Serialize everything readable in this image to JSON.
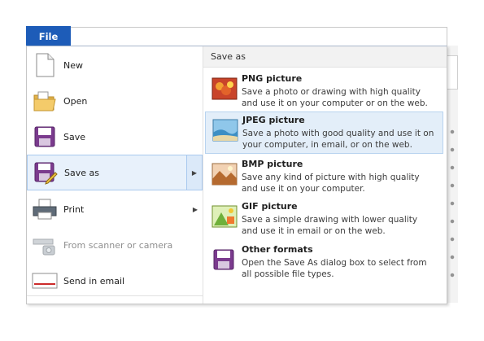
{
  "file_tab": {
    "label": "File"
  },
  "left_menu": {
    "items": [
      {
        "label": "New",
        "icon": "new-document-icon",
        "disabled": false,
        "submenu": false
      },
      {
        "label": "Open",
        "icon": "open-folder-icon",
        "disabled": false,
        "submenu": false
      },
      {
        "label": "Save",
        "icon": "save-floppy-icon",
        "disabled": false,
        "submenu": false
      },
      {
        "label": "Save as",
        "icon": "save-as-icon",
        "disabled": false,
        "submenu": true,
        "selected": true
      },
      {
        "label": "Print",
        "icon": "printer-icon",
        "disabled": false,
        "submenu": true
      },
      {
        "label": "From scanner or camera",
        "icon": "scanner-camera-icon",
        "disabled": true,
        "submenu": false
      },
      {
        "label": "Send in email",
        "icon": "email-icon",
        "disabled": false,
        "submenu": false
      }
    ],
    "submenu_arrow": "▶"
  },
  "save_as_panel": {
    "header": "Save as",
    "options": [
      {
        "title": "PNG picture",
        "description": "Save a photo or drawing with high quality and use it on your computer or on the web.",
        "icon": "png-picture-icon"
      },
      {
        "title": "JPEG picture",
        "description": "Save a photo with good quality and use it on your computer, in email, or on the web.",
        "icon": "jpeg-picture-icon",
        "highlighted": true
      },
      {
        "title": "BMP picture",
        "description": "Save any kind of picture with high quality and use it on your computer.",
        "icon": "bmp-picture-icon"
      },
      {
        "title": "GIF picture",
        "description": "Save a simple drawing with lower quality and use it in email or on the web.",
        "icon": "gif-picture-icon"
      },
      {
        "title": "Other formats",
        "description": "Open the Save As dialog box to select from all possible file types.",
        "icon": "other-formats-icon"
      }
    ]
  },
  "colors": {
    "file_tab": "#1d5cb8",
    "selection_bg": "#e8f1fb",
    "selection_border": "#a9c9ee",
    "header_bg": "#f2f2f2"
  }
}
